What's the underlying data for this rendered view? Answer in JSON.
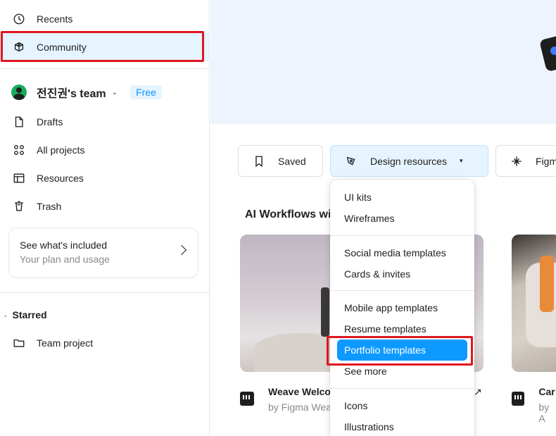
{
  "sidebar": {
    "nav_top": [
      {
        "label": "Recents",
        "icon": "clock-icon"
      },
      {
        "label": "Community",
        "icon": "community-icon",
        "active": true
      }
    ],
    "team": {
      "name": "전진권's team",
      "badge": "Free"
    },
    "nav_team": [
      {
        "label": "Drafts",
        "icon": "file-icon"
      },
      {
        "label": "All projects",
        "icon": "grid-icon"
      },
      {
        "label": "Resources",
        "icon": "resources-icon"
      },
      {
        "label": "Trash",
        "icon": "trash-icon"
      }
    ],
    "plan_card": {
      "title": "See what's included",
      "subtitle": "Your plan and usage"
    },
    "starred": {
      "label": "Starred",
      "items": [
        {
          "label": "Team project",
          "icon": "folder-icon"
        }
      ]
    }
  },
  "main": {
    "pills": [
      {
        "label": "Saved",
        "icon": "bookmark-icon"
      },
      {
        "label": "Design resources",
        "icon": "design-resources-icon",
        "active": true
      },
      {
        "label": "Figm",
        "icon": "plugin-icon"
      }
    ],
    "section_title": "AI Workflows wi",
    "cards": [
      {
        "title": "Weave Welco",
        "author": "by Figma Wea"
      },
      {
        "title": "Car",
        "author": "by A"
      }
    ]
  },
  "dropdown": {
    "groups": [
      [
        "UI kits",
        "Wireframes"
      ],
      [
        "Social media templates",
        "Cards & invites"
      ],
      [
        "Mobile app templates",
        "Resume templates",
        "Portfolio templates",
        "See more"
      ],
      [
        "Icons",
        "Illustrations"
      ]
    ],
    "selected": "Portfolio templates"
  },
  "colors": {
    "accent": "#0d99ff",
    "highlight": "#e0161f",
    "active_bg": "#e5f4ff"
  }
}
